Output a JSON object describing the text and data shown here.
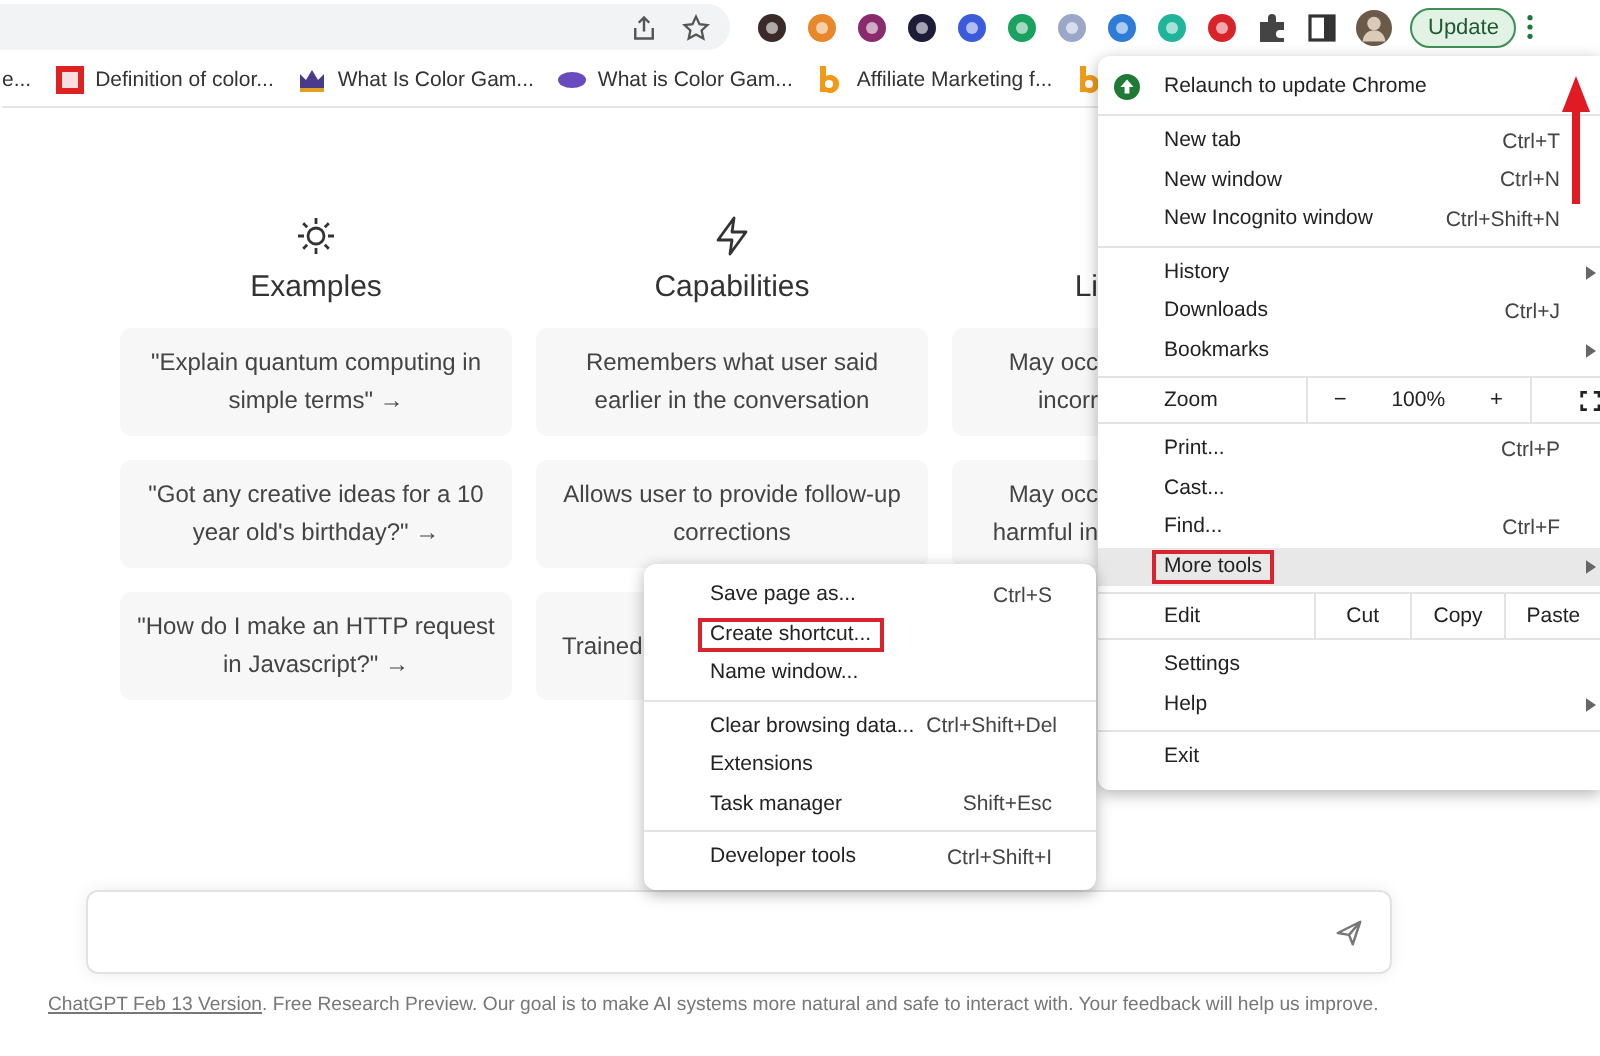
{
  "toolbar": {
    "update_button": "Update"
  },
  "bookmarks": [
    {
      "kind": "none",
      "label": "e..."
    },
    {
      "kind": "pc",
      "label": "Definition of color..."
    },
    {
      "kind": "crown",
      "label": "What Is Color Gam..."
    },
    {
      "kind": "oval",
      "label": "What is Color Gam..."
    },
    {
      "kind": "b",
      "label": "Affiliate Marketing f..."
    },
    {
      "kind": "b"
    }
  ],
  "columns": [
    {
      "title": "Examples",
      "cards": [
        "\"Explain quantum computing in simple terms\" →",
        "\"Got any creative ideas for a 10 year old's birthday?\" →",
        "\"How do I make an HTTP request in Javascript?\" →"
      ]
    },
    {
      "title": "Capabilities",
      "cards": [
        "Remembers what user said earlier in the conversation",
        "Allows user to provide follow-up corrections",
        "Trained"
      ]
    },
    {
      "title": "Li",
      "cards": [
        "May occ\nincorr",
        "May occ\nharmful in"
      ]
    }
  ],
  "footer": {
    "link": "ChatGPT Feb 13 Version",
    "text": ". Free Research Preview. Our goal is to make AI systems more natural and safe to interact with. Your feedback will help us improve."
  },
  "chrome_menu": {
    "groups": [
      [
        {
          "kind": "relaunch",
          "label": "Relaunch to update Chrome"
        }
      ],
      [
        {
          "kind": "item",
          "label": "New tab",
          "shortcut": "Ctrl+T"
        },
        {
          "kind": "item",
          "label": "New window",
          "shortcut": "Ctrl+N"
        },
        {
          "kind": "item",
          "label": "New Incognito window",
          "shortcut": "Ctrl+Shift+N"
        }
      ],
      [
        {
          "kind": "item",
          "label": "History",
          "submenu": true
        },
        {
          "kind": "item",
          "label": "Downloads",
          "shortcut": "Ctrl+J"
        },
        {
          "kind": "item",
          "label": "Bookmarks",
          "submenu": true
        }
      ],
      [
        {
          "kind": "zoom",
          "label": "Zoom",
          "minus": "−",
          "value": "100%",
          "plus": "+"
        }
      ],
      [
        {
          "kind": "item",
          "label": "Print...",
          "shortcut": "Ctrl+P"
        },
        {
          "kind": "item",
          "label": "Cast..."
        },
        {
          "kind": "item",
          "label": "Find...",
          "shortcut": "Ctrl+F"
        },
        {
          "kind": "item",
          "label": "More tools",
          "submenu": true,
          "selected": true,
          "marked": true
        }
      ],
      [
        {
          "kind": "edit",
          "label": "Edit",
          "buttons": [
            "Cut",
            "Copy",
            "Paste"
          ]
        }
      ],
      [
        {
          "kind": "item",
          "label": "Settings"
        },
        {
          "kind": "item",
          "label": "Help",
          "submenu": true
        }
      ],
      [
        {
          "kind": "item",
          "label": "Exit"
        }
      ]
    ]
  },
  "more_tools_menu": {
    "groups": [
      [
        {
          "label": "Save page as...",
          "shortcut": "Ctrl+S",
          "marked": false
        },
        {
          "label": "Create shortcut...",
          "marked": true
        },
        {
          "label": "Name window...",
          "marked": false
        }
      ],
      [
        {
          "label": "Clear browsing data...",
          "shortcut": "Ctrl+Shift+Del",
          "marked": false
        },
        {
          "label": "Extensions",
          "marked": false
        },
        {
          "label": "Task manager",
          "shortcut": "Shift+Esc",
          "marked": false
        }
      ],
      [
        {
          "label": "Developer tools",
          "shortcut": "Ctrl+Shift+I",
          "marked": false
        }
      ]
    ]
  }
}
